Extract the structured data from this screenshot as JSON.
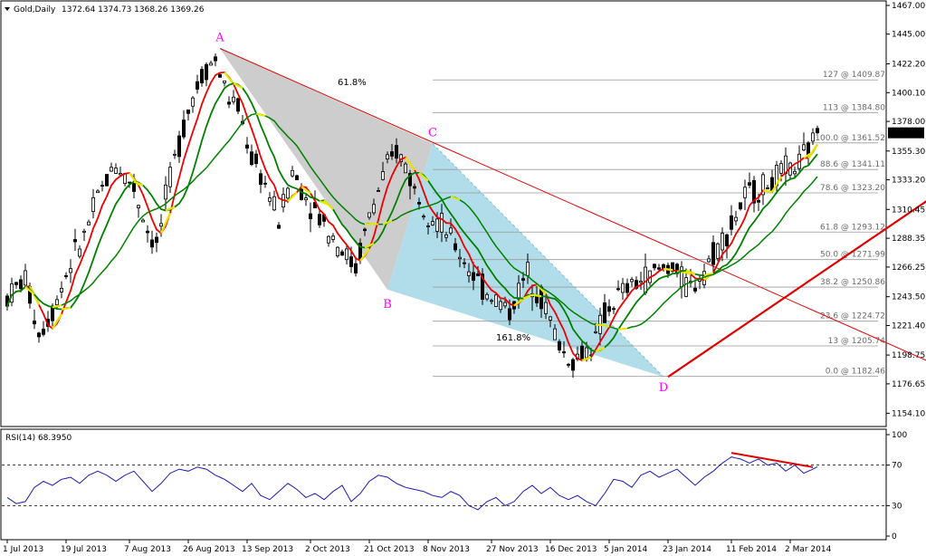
{
  "header": {
    "symbol": "Gold,Daily",
    "ohlc": "1372.64 1374.73 1368.26 1369.26"
  },
  "rsi_header": {
    "label": "RSI(14) 68.3950"
  },
  "colors": {
    "bull": "#000000",
    "bear": "#000000",
    "ma_fast": "#ee0000",
    "ma_mid": "#008000",
    "ma_slow": "#008000",
    "ma_turn": "#e6e600",
    "fib_line": "#9a9a9a",
    "pattern_abc": "#c8c8c8",
    "pattern_bcd": "#a8d8e8",
    "trend_down": "#e00000",
    "trend_up": "#e00000",
    "rsi": "#1c1cb4",
    "rsi_div": "#e00000",
    "points": "#ff00ff",
    "price_box_bg": "#000000",
    "price_box_fg": "#ffffff"
  },
  "chart_data": [
    {
      "type": "candlestick",
      "title": "Gold,Daily",
      "ylim": [
        1146.0,
        1467.0
      ],
      "y_ticks": [
        1154.1,
        1176.65,
        1198.75,
        1221.4,
        1243.5,
        1266.25,
        1288.35,
        1310.45,
        1333.2,
        1355.3,
        1378.0,
        1400.1,
        1422.2,
        1445.0,
        1467.0
      ],
      "y_tick_labels": [
        "1154.10",
        "1176.65",
        "1198.75",
        "1221.40",
        "1243.50",
        "1266.25",
        "1288.35",
        "1310.45",
        "1333.20",
        "1355.30",
        "1378.00",
        "1400.10",
        "1422.20",
        "1445.00",
        "1467.00"
      ],
      "x_tick_labels": [
        "1 Jul 2013",
        "19 Jul 2013",
        "7 Aug 2013",
        "26 Aug 2013",
        "13 Sep 2013",
        "2 Oct 2013",
        "21 Oct 2013",
        "8 Nov 2013",
        "27 Nov 2013",
        "16 Dec 2013",
        "5 Jan 2014",
        "23 Jan 2014",
        "11 Feb 2014",
        "2 Mar 2014"
      ],
      "x_tick_index": [
        0,
        13,
        27,
        40,
        53,
        67,
        80,
        93,
        107,
        120,
        133,
        146,
        160,
        173
      ],
      "n_bars": 180,
      "current_price": "1369.26",
      "price_path": [
        [
          0,
          1243
        ],
        [
          4,
          1258
        ],
        [
          7,
          1215
        ],
        [
          10,
          1233
        ],
        [
          14,
          1270
        ],
        [
          17,
          1290
        ],
        [
          20,
          1320
        ],
        [
          24,
          1346
        ],
        [
          28,
          1327
        ],
        [
          31,
          1295
        ],
        [
          33,
          1282
        ],
        [
          36,
          1335
        ],
        [
          39,
          1375
        ],
        [
          41,
          1398
        ],
        [
          44,
          1420
        ],
        [
          46,
          1425
        ],
        [
          49,
          1395
        ],
        [
          51,
          1388
        ],
        [
          54,
          1350
        ],
        [
          57,
          1330
        ],
        [
          60,
          1302
        ],
        [
          63,
          1340
        ],
        [
          66,
          1320
        ],
        [
          69,
          1305
        ],
        [
          72,
          1290
        ],
        [
          75,
          1275
        ],
        [
          77,
          1265
        ],
        [
          80,
          1305
        ],
        [
          83,
          1335
        ],
        [
          86,
          1355
        ],
        [
          88,
          1345
        ],
        [
          90,
          1325
        ],
        [
          93,
          1310
        ],
        [
          96,
          1298
        ],
        [
          99,
          1282
        ],
        [
          102,
          1266
        ],
        [
          105,
          1250
        ],
        [
          108,
          1242
        ],
        [
          111,
          1232
        ],
        [
          113,
          1248
        ],
        [
          115,
          1262
        ],
        [
          117,
          1250
        ],
        [
          119,
          1235
        ],
        [
          121,
          1215
        ],
        [
          123,
          1200
        ],
        [
          125,
          1194
        ],
        [
          128,
          1203
        ],
        [
          130,
          1210
        ],
        [
          132,
          1230
        ],
        [
          135,
          1244
        ],
        [
          138,
          1252
        ],
        [
          141,
          1258
        ],
        [
          144,
          1264
        ],
        [
          147,
          1268
        ],
        [
          149,
          1256
        ],
        [
          151,
          1250
        ],
        [
          154,
          1265
        ],
        [
          157,
          1282
        ],
        [
          160,
          1298
        ],
        [
          163,
          1320
        ],
        [
          166,
          1326
        ],
        [
          169,
          1332
        ],
        [
          172,
          1340
        ],
        [
          175,
          1345
        ],
        [
          178,
          1362
        ],
        [
          179,
          1369.26
        ]
      ],
      "price_open": 1372.64,
      "price_high": 1374.73,
      "price_low": 1368.26,
      "price_close": 1369.26
    },
    {
      "type": "fibonacci",
      "levels": [
        {
          "label": "127 @ 1409.87",
          "value": 1409.87
        },
        {
          "label": "113 @ 1384.80",
          "value": 1384.8
        },
        {
          "label": "100.0 @ 1361.52",
          "value": 1361.52
        },
        {
          "label": "88.6 @ 1341.11",
          "value": 1341.11
        },
        {
          "label": "78.6 @ 1323.20",
          "value": 1323.2
        },
        {
          "label": "61.8 @ 1293.12",
          "value": 1293.12
        },
        {
          "label": "50.0 @ 1271.99",
          "value": 1271.99
        },
        {
          "label": "38.2 @ 1250.86",
          "value": 1250.86
        },
        {
          "label": "23.6 @ 1224.72",
          "value": 1224.72
        },
        {
          "label": "13 @ 1205.74",
          "value": 1205.74
        },
        {
          "label": "0.0 @ 1182.46",
          "value": 1182.46
        }
      ],
      "start_index": 94
    },
    {
      "type": "pattern",
      "points": [
        {
          "label": "A",
          "index": 47,
          "value": 1434
        },
        {
          "label": "B",
          "index": 84,
          "value": 1249
        },
        {
          "label": "C",
          "index": 94,
          "value": 1361
        },
        {
          "label": "D",
          "index": 145,
          "value": 1182
        }
      ],
      "ratios": [
        {
          "label": "61.8%",
          "index": 73,
          "value": 1406
        },
        {
          "label": "161.8%",
          "index": 108,
          "value": 1210
        }
      ]
    },
    {
      "type": "trendlines",
      "lines": [
        {
          "name": "downtrend",
          "from": [
            47,
            1434
          ],
          "to": [
            225,
            1161
          ]
        },
        {
          "name": "uptrend",
          "from": [
            146,
            1182
          ],
          "to": [
            207,
            1326
          ]
        }
      ]
    },
    {
      "type": "line",
      "title": "RSI(14) 68.3950",
      "ylim": [
        0,
        100
      ],
      "y_ticks": [
        0,
        30,
        70,
        100
      ],
      "y_tick_labels": [
        "0",
        "30",
        "70",
        "100"
      ],
      "levels": [
        30,
        70
      ],
      "current": 68.395,
      "rsi_path": [
        [
          0,
          38
        ],
        [
          2,
          32
        ],
        [
          4,
          34
        ],
        [
          6,
          48
        ],
        [
          8,
          54
        ],
        [
          10,
          50
        ],
        [
          12,
          56
        ],
        [
          14,
          58
        ],
        [
          16,
          52
        ],
        [
          18,
          60
        ],
        [
          20,
          64
        ],
        [
          22,
          60
        ],
        [
          24,
          54
        ],
        [
          26,
          60
        ],
        [
          28,
          64
        ],
        [
          30,
          54
        ],
        [
          32,
          44
        ],
        [
          34,
          52
        ],
        [
          36,
          62
        ],
        [
          38,
          66
        ],
        [
          40,
          64
        ],
        [
          42,
          68
        ],
        [
          44,
          66
        ],
        [
          46,
          60
        ],
        [
          48,
          56
        ],
        [
          50,
          50
        ],
        [
          52,
          44
        ],
        [
          54,
          52
        ],
        [
          56,
          40
        ],
        [
          58,
          36
        ],
        [
          60,
          44
        ],
        [
          62,
          52
        ],
        [
          64,
          46
        ],
        [
          66,
          38
        ],
        [
          68,
          42
        ],
        [
          70,
          36
        ],
        [
          72,
          44
        ],
        [
          74,
          50
        ],
        [
          76,
          34
        ],
        [
          78,
          42
        ],
        [
          80,
          54
        ],
        [
          82,
          60
        ],
        [
          84,
          58
        ],
        [
          86,
          52
        ],
        [
          88,
          48
        ],
        [
          90,
          46
        ],
        [
          92,
          44
        ],
        [
          94,
          40
        ],
        [
          96,
          38
        ],
        [
          98,
          44
        ],
        [
          100,
          40
        ],
        [
          102,
          30
        ],
        [
          104,
          26
        ],
        [
          106,
          34
        ],
        [
          108,
          38
        ],
        [
          110,
          30
        ],
        [
          112,
          34
        ],
        [
          114,
          44
        ],
        [
          116,
          50
        ],
        [
          118,
          42
        ],
        [
          120,
          48
        ],
        [
          122,
          40
        ],
        [
          124,
          36
        ],
        [
          126,
          40
        ],
        [
          128,
          34
        ],
        [
          130,
          30
        ],
        [
          132,
          42
        ],
        [
          134,
          56
        ],
        [
          136,
          54
        ],
        [
          138,
          48
        ],
        [
          140,
          60
        ],
        [
          142,
          64
        ],
        [
          144,
          58
        ],
        [
          146,
          62
        ],
        [
          148,
          66
        ],
        [
          150,
          58
        ],
        [
          152,
          50
        ],
        [
          154,
          58
        ],
        [
          156,
          64
        ],
        [
          158,
          72
        ],
        [
          160,
          78
        ],
        [
          162,
          76
        ],
        [
          164,
          72
        ],
        [
          166,
          76
        ],
        [
          168,
          70
        ],
        [
          170,
          72
        ],
        [
          172,
          64
        ],
        [
          174,
          70
        ],
        [
          176,
          62
        ],
        [
          178,
          66
        ],
        [
          179,
          68.395
        ]
      ],
      "divergence": {
        "from": [
          160,
          82
        ],
        "to": [
          178,
          68
        ]
      }
    }
  ]
}
